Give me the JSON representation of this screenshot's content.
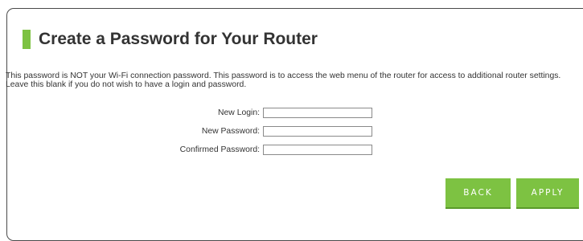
{
  "header": {
    "title": "Create a Password for Your Router",
    "accent_color": "#7dc242"
  },
  "intro": {
    "text": "This password is NOT your Wi-Fi connection password. This password is to access the web menu of the router for access to additional router settings. Leave this blank if you do not wish to have a login and password."
  },
  "form": {
    "new_login": {
      "label": "New Login:",
      "value": ""
    },
    "new_password": {
      "label": "New Password:",
      "value": ""
    },
    "confirmed_password": {
      "label": "Confirmed Password:",
      "value": ""
    }
  },
  "buttons": {
    "back_label": "BACK",
    "apply_label": "APPLY",
    "color": "#7dc242"
  }
}
